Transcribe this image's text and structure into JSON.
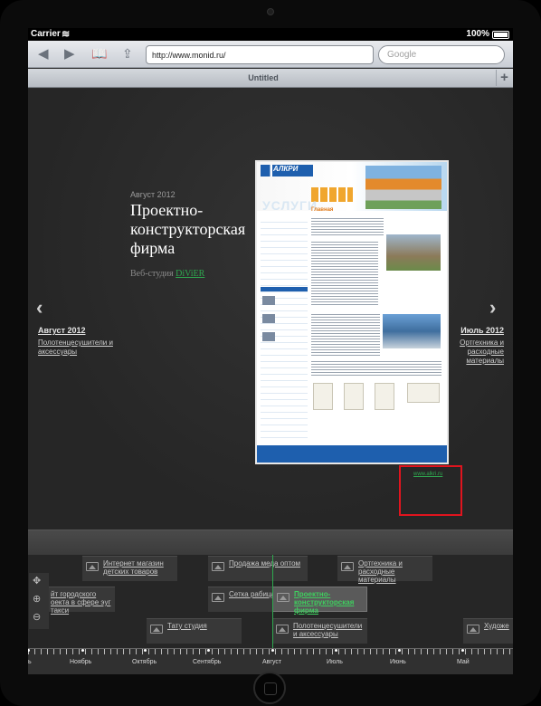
{
  "status": {
    "carrier": "Carrier",
    "wifi_icon": "wifi-icon",
    "time": "",
    "battery": "100%"
  },
  "toolbar": {
    "url": "http://www.monid.ru/",
    "search_placeholder": "Google"
  },
  "tabbar": {
    "title": "Untitled",
    "add_label": "+"
  },
  "current_item": {
    "date": "Август 2012",
    "title_line1": "Проектно-",
    "title_line2": "конструкторская",
    "title_line3": "фирма",
    "studio_prefix": "Веб-студия ",
    "studio_name": "DiViER",
    "site_link": "www.alkri.ru"
  },
  "preview": {
    "logo": "АЛКРИ",
    "section": "УСЛУГИ",
    "heading": "Главная"
  },
  "prev_item": {
    "arrow": "‹",
    "date": "Август 2012",
    "desc": "Полотенцесушители и аксессуары"
  },
  "next_item": {
    "arrow": "›",
    "date": "Июль 2012",
    "desc": "Ортгехника и расходные материалы"
  },
  "timeline": {
    "cards": [
      {
        "label": "Интернет магазин детских товаров"
      },
      {
        "label": "Продажа меда оптом"
      },
      {
        "label": "Ортгехника и расходные материалы"
      },
      {
        "label": "йт городского оекта в сфере эуг такси"
      },
      {
        "label": "Сетка рабица"
      },
      {
        "label": "Проектно-конструкторская фирма"
      },
      {
        "label": "Тату студия"
      },
      {
        "label": "Полотенцесушители и аксессуары"
      },
      {
        "label": "Художе"
      }
    ],
    "zoom": {
      "nav": "✥",
      "zoom_in": "⊕",
      "zoom_out": "⊖"
    },
    "months": [
      "ь",
      "Ноябрь",
      "Октябрь",
      "Сентябрь",
      "Август",
      "Июль",
      "Июнь",
      "Май"
    ]
  },
  "colors": {
    "accent_green": "#2ea84f",
    "highlight_red": "#e0141e"
  }
}
